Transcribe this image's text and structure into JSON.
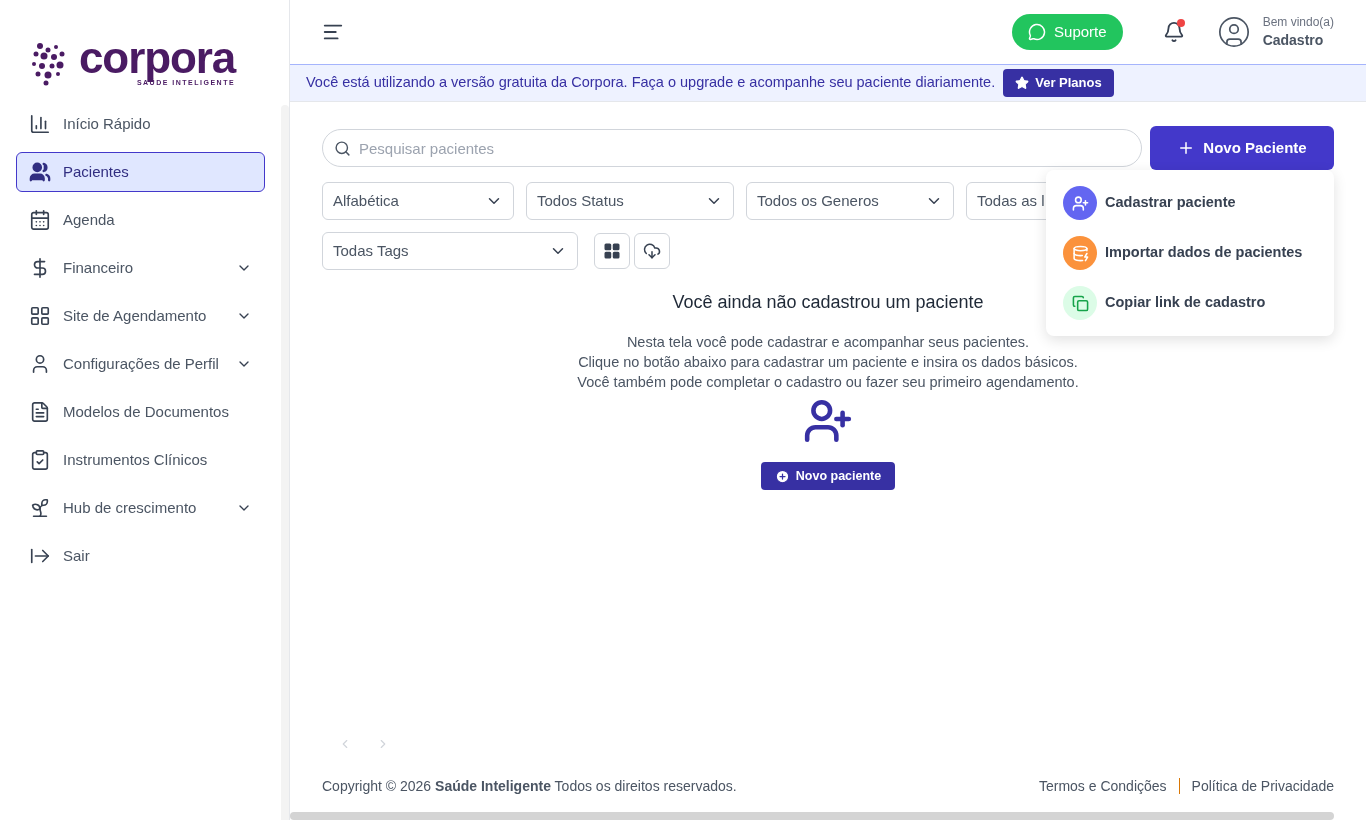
{
  "logo": {
    "name": "corpora",
    "tagline": "SAÚDE INTELIGENTE"
  },
  "sidebar": {
    "items": [
      {
        "label": "Início Rápido",
        "selected": false,
        "kind": "link"
      },
      {
        "label": "Pacientes",
        "selected": true,
        "kind": "link"
      },
      {
        "label": "Agenda",
        "selected": false,
        "kind": "link"
      },
      {
        "label": "Financeiro",
        "selected": false,
        "kind": "group"
      },
      {
        "label": "Site de Agendamento",
        "selected": false,
        "kind": "group"
      },
      {
        "label": "Configurações de Perfil",
        "selected": false,
        "kind": "group"
      },
      {
        "label": "Modelos de Documentos",
        "selected": false,
        "kind": "link"
      },
      {
        "label": "Instrumentos Clínicos",
        "selected": false,
        "kind": "link"
      },
      {
        "label": "Hub de crescimento",
        "selected": false,
        "kind": "group"
      },
      {
        "label": "Sair",
        "selected": false,
        "kind": "link"
      }
    ]
  },
  "header": {
    "support_button": "Suporte",
    "notification_unread": true,
    "greeting": "Bem vindo(a)",
    "user_name": "Cadastro"
  },
  "banner": {
    "text": "Você está utilizando a versão gratuita da Corpora. Faça o upgrade e acompanhe seu paciente diariamente.",
    "button": "Ver Planos"
  },
  "search": {
    "placeholder": "Pesquisar pacientes"
  },
  "new_patient_button": "Novo Paciente",
  "filters": [
    "Alfabética",
    "Todos Status",
    "Todos os Generos",
    "Todas as l"
  ],
  "tags_filter": "Todas Tags",
  "new_menu": {
    "items": [
      {
        "label": "Cadastrar paciente",
        "color": "#6366f1"
      },
      {
        "label": "Importar dados de pacientes",
        "color": "#fb923c"
      },
      {
        "label": "Copiar link de cadastro",
        "color": "#dcfce7"
      }
    ]
  },
  "empty_state": {
    "title": "Você ainda não cadastrou um paciente",
    "lines": [
      "Nesta tela você pode cadastrar e acompanhar seus pacientes.",
      "Clique no botão abaixo para cadastrar um paciente e insira os dados básicos.",
      "Você também pode completar o cadastro ou fazer seu primeiro agendamento."
    ],
    "button": "Novo paciente"
  },
  "footer": {
    "copyright": "Copyright © 2026 **Saúde Inteligente** Todos os direitos reservados.",
    "links": [
      "Termos e Condições",
      "Política de Privacidade"
    ]
  }
}
